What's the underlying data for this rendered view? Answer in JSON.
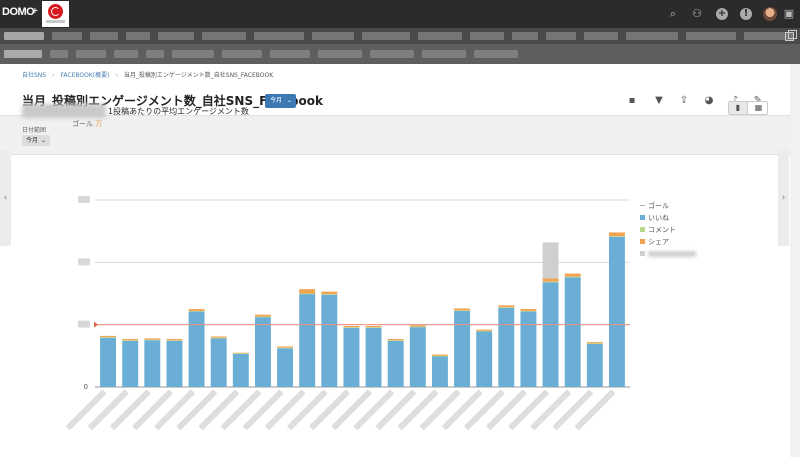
{
  "brand": {
    "logo_text": "DOMO",
    "plus": "+"
  },
  "breadcrumb": {
    "items": [
      "自社SNS",
      "FACEBOOK(概要)",
      "当月_投稿別エンゲージメント数_自社SNS_FACEBOOK"
    ]
  },
  "page": {
    "title": "当月_投稿別エンゲージメント数_自社SNS_Facebook",
    "period_button": "今月"
  },
  "filter": {
    "label": "日付範囲",
    "value": "今月"
  },
  "chart_header": {
    "title": "1投稿あたりの平均エンゲージメント数",
    "goal_label": "ゴール",
    "goal_unit": "万"
  },
  "icons": {
    "top": [
      "search-icon",
      "add-user-icon",
      "add-icon",
      "notification-icon",
      "avatar",
      "chat-icon"
    ],
    "card": [
      "comment-icon",
      "filter-icon",
      "share-icon",
      "pie-chart-icon",
      "alert-icon",
      "wrench-icon"
    ]
  },
  "colors": {
    "likes": "#6aaed6",
    "comments": "#b6d98e",
    "shares": "#f0a452",
    "other": "#cfcfcf",
    "goal": "#f09080"
  },
  "chart_data": {
    "type": "bar",
    "stacked": true,
    "ylim": [
      0,
      3
    ],
    "yticks_visible": [
      "0"
    ],
    "goal_value": 1.0,
    "categories_count": 23,
    "series": [
      {
        "name": "いいね",
        "values": [
          0.79,
          0.74,
          0.75,
          0.74,
          1.21,
          0.78,
          0.53,
          1.12,
          0.62,
          1.49,
          1.48,
          0.95,
          0.95,
          0.74,
          0.96,
          0.49,
          1.22,
          0.89,
          1.27,
          1.21,
          1.68,
          1.76,
          0.69,
          2.41
        ]
      },
      {
        "name": "コメント",
        "values": [
          0.01,
          0.01,
          0.01,
          0.01,
          0.01,
          0.01,
          0.01,
          0.01,
          0.01,
          0.01,
          0.01,
          0.01,
          0.01,
          0.01,
          0.01,
          0.01,
          0.01,
          0.01,
          0.01,
          0.01,
          0.01,
          0.01,
          0.01,
          0.01
        ]
      },
      {
        "name": "シェア",
        "values": [
          0.02,
          0.02,
          0.02,
          0.02,
          0.03,
          0.02,
          0.01,
          0.03,
          0.02,
          0.07,
          0.04,
          0.02,
          0.02,
          0.02,
          0.02,
          0.02,
          0.03,
          0.02,
          0.03,
          0.03,
          0.05,
          0.05,
          0.02,
          0.06
        ]
      },
      {
        "name": "",
        "values": [
          0,
          0,
          0,
          0,
          0,
          0,
          0,
          0,
          0,
          0,
          0,
          0,
          0,
          0,
          0,
          0,
          0,
          0,
          0,
          0,
          0.58,
          0,
          0,
          0
        ]
      }
    ],
    "legend": [
      "ゴール",
      "いいね",
      "コメント",
      "シェア"
    ],
    "legend_position": "right"
  }
}
